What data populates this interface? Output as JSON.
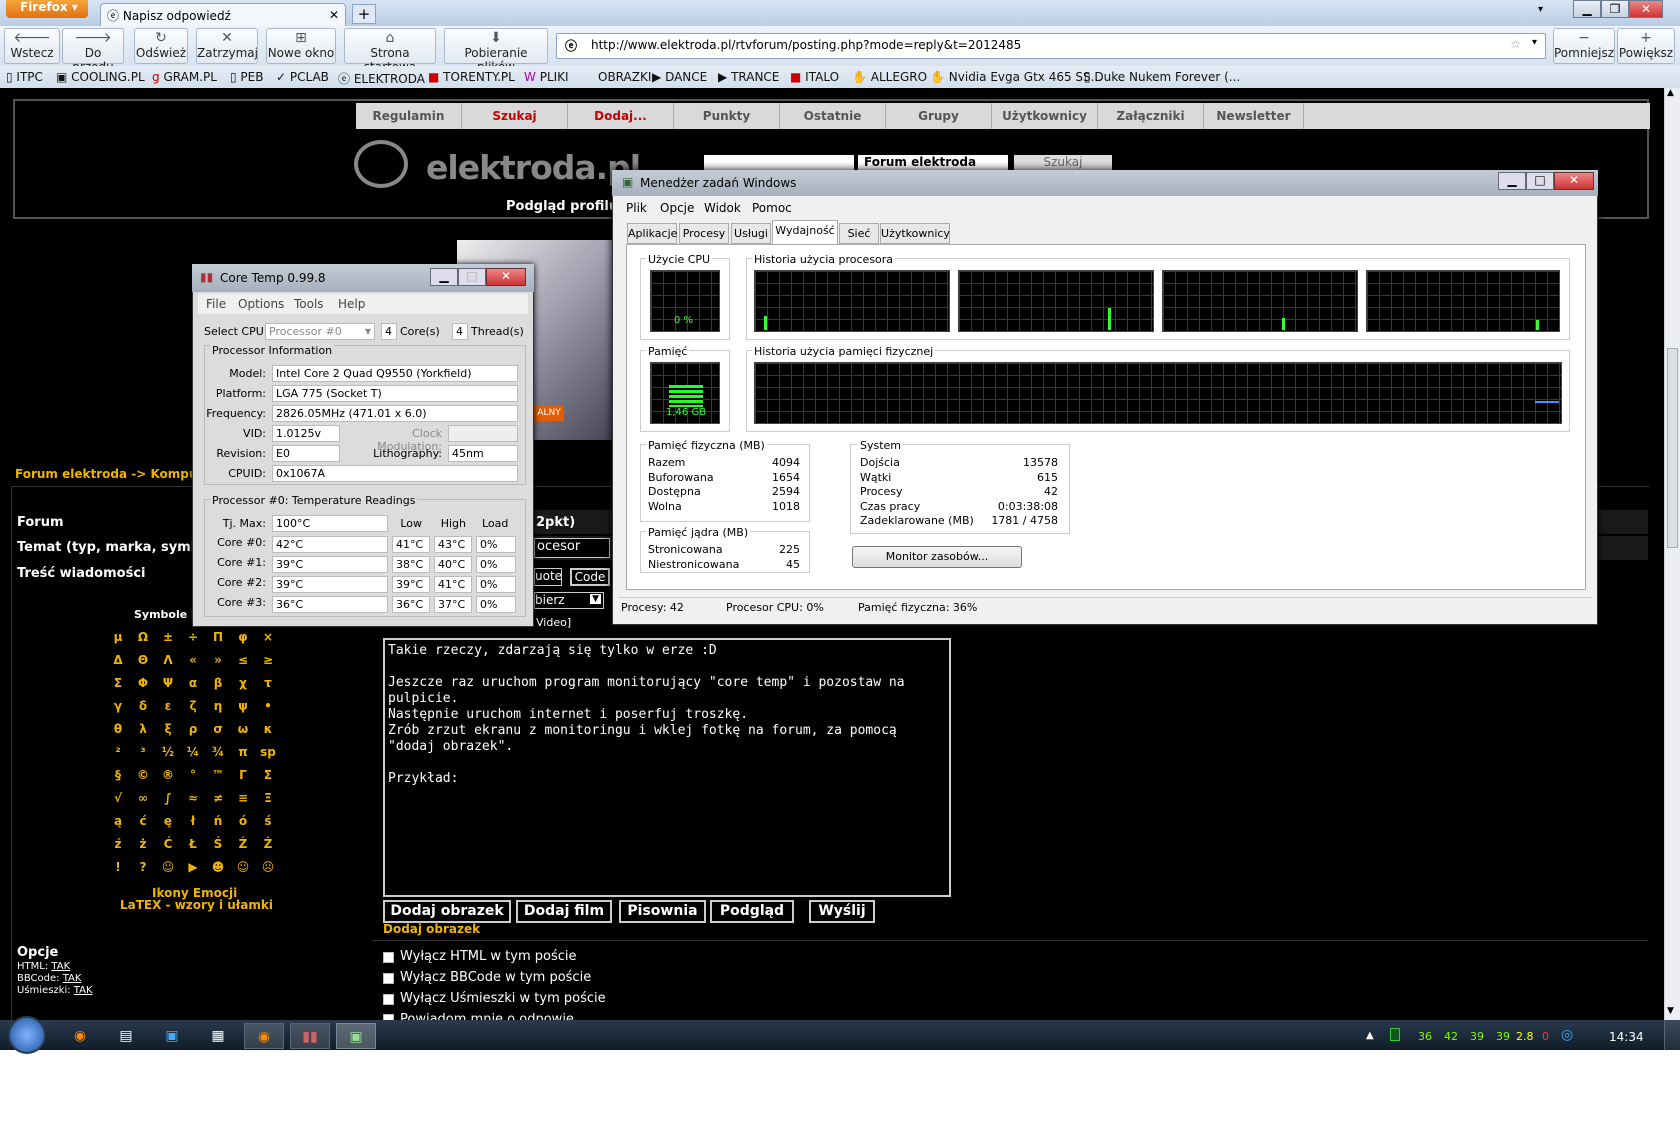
{
  "browser": {
    "menu_label": "Firefox",
    "tab_title": "Napisz odpowiedź",
    "url": "http://www.elektroda.pl/rtvforum/posting.php?mode=reply&t=2012485",
    "nav": {
      "back": "Wstecz",
      "forward": "Do przodu",
      "reload": "Odśwież",
      "stop": "Zatrzymaj",
      "new_window": "Nowe okno",
      "home": "Strona startowa",
      "downloads": "Pobieranie plików",
      "zoom_out": "Pomniejsz",
      "zoom_in": "Powiększ"
    },
    "bookmarks": [
      "ITPC",
      "COOLING.PL",
      "GRAM.PL",
      "PEB",
      "PCLAB",
      "ELEKTRODA",
      "TORENTY.PL",
      "PLIKI",
      "OBRAZKI",
      "DANCE",
      "TRANCE",
      "ITALO",
      "ALLEGRO",
      "Nvidia Evga Gtx 465 SS...",
      "Duke Nukem Forever (..."
    ]
  },
  "site": {
    "menu": [
      "Regulamin",
      "Szukaj",
      "Dodaj...",
      "Punkty",
      "Ostatnie",
      "Grupy",
      "Użytkownicy",
      "Załączniki",
      "Newsletter"
    ],
    "logo_text": "elektroda.pl",
    "search_select": "Forum elektroda",
    "search_btn": "Szukaj",
    "profile_preview": "Podgląd profilu",
    "breadcrumb": "Forum elektroda -> Kompu",
    "ad_badge": "ALNY",
    "labels": {
      "forum": "Forum",
      "topic": "Temat (typ, marka, symbo",
      "message": "Treść wiadomości",
      "symbols": "Symbole i",
      "pkt": "2pkt)",
      "topic_value": "ocesor",
      "quote": "uote",
      "code": "Code",
      "select": "bierz",
      "video": "Video]"
    },
    "symbols": [
      [
        "µ",
        "Ω",
        "±",
        "÷",
        "Π",
        "φ",
        "×"
      ],
      [
        "Δ",
        "Θ",
        "Λ",
        "«",
        "»",
        "≤",
        "≥"
      ],
      [
        "Σ",
        "Φ",
        "Ψ",
        "α",
        "β",
        "χ",
        "τ"
      ],
      [
        "γ",
        "δ",
        "ε",
        "ζ",
        "η",
        "ψ",
        "•"
      ],
      [
        "θ",
        "λ",
        "ξ",
        "ρ",
        "σ",
        "ω",
        "κ"
      ],
      [
        "²",
        "³",
        "½",
        "¼",
        "¾",
        "π",
        "sp"
      ],
      [
        "§",
        "©",
        "®",
        "°",
        "™",
        "Γ",
        "Σ"
      ],
      [
        "√",
        "∞",
        "∫",
        "≈",
        "≠",
        "≡",
        "Ξ"
      ],
      [
        "ą",
        "ć",
        "ę",
        "ł",
        "ń",
        "ó",
        "ś"
      ],
      [
        "ź",
        "ż",
        "Ć",
        "Ł",
        "Ś",
        "Ź",
        "Ż"
      ],
      [
        "!",
        "?",
        "☺",
        "▶",
        "☻",
        "☺",
        "☹"
      ]
    ],
    "emoticons": "Ikony Emocji",
    "latex": "LaTEX - wzory i ułamki",
    "message_text": "Takie rzeczy, zdarzają się tylko w erze :D\n\nJeszcze raz uruchom program monitorujący \"core temp\" i pozostaw na pulpicie.\nNastępnie uruchom internet i poserfuj troszkę.\nZrób zrzut ekranu z monitoringu i wklej fotkę na forum, za pomocą \"dodaj obrazek\".\n\nPrzykład:",
    "buttons": [
      "Dodaj obrazek",
      "Dodaj film",
      "Pisownia",
      "Podgląd",
      "Wyślij"
    ],
    "add_image_link": "Dodaj obrazek",
    "options": {
      "title": "Opcje",
      "html": "HTML:",
      "bbcode": "BBCode:",
      "smilies": "Uśmieszki:",
      "yes": "TAK"
    },
    "checkboxes": [
      "Wyłącz HTML w tym poście",
      "Wyłącz BBCode w tym poście",
      "Wyłącz Uśmieszki w tym poście",
      "Powiadom mnie o odpowie"
    ]
  },
  "coretemp": {
    "title": "Core Temp 0.99.8",
    "menu": [
      "File",
      "Options",
      "Tools",
      "Help"
    ],
    "select_cpu_label": "Select CPU:",
    "select_cpu": "Processor #0",
    "cores": "4",
    "cores_label": "Core(s)",
    "threads": "4",
    "threads_label": "Thread(s)",
    "info_header": "Processor Information",
    "model_label": "Model:",
    "model": "Intel Core 2 Quad Q9550 (Yorkfield)",
    "platform_label": "Platform:",
    "platform": "LGA 775 (Socket T)",
    "freq_label": "Frequency:",
    "freq": "2826.05MHz (471.01 x 6.0)",
    "vid_label": "VID:",
    "vid": "1.0125v",
    "clockmod_label": "Clock Modulation:",
    "revision_label": "Revision:",
    "revision": "E0",
    "litho_label": "Lithography:",
    "litho": "45nm",
    "cpuid_label": "CPUID:",
    "cpuid": "0x1067A",
    "temp_header": "Processor #0: Temperature Readings",
    "tjmax_label": "Tj. Max:",
    "tjmax": "100°C",
    "col_low": "Low",
    "col_high": "High",
    "col_load": "Load",
    "cores_data": [
      {
        "name": "Core #0:",
        "temp": "42°C",
        "low": "41°C",
        "high": "43°C",
        "load": "0%"
      },
      {
        "name": "Core #1:",
        "temp": "39°C",
        "low": "38°C",
        "high": "40°C",
        "load": "0%"
      },
      {
        "name": "Core #2:",
        "temp": "39°C",
        "low": "39°C",
        "high": "41°C",
        "load": "0%"
      },
      {
        "name": "Core #3:",
        "temp": "36°C",
        "low": "36°C",
        "high": "37°C",
        "load": "0%"
      }
    ]
  },
  "taskmgr": {
    "title": "Menedżer zadań Windows",
    "menu": [
      "Plik",
      "Opcje",
      "Widok",
      "Pomoc"
    ],
    "tabs": [
      "Aplikacje",
      "Procesy",
      "Usługi",
      "Wydajność",
      "Sieć",
      "Użytkownicy"
    ],
    "cpu_usage_label": "Użycie CPU",
    "cpu_usage": "0 %",
    "cpu_history_label": "Historia użycia procesora",
    "mem_label": "Pamięć",
    "mem_value": "1,46 GB",
    "mem_history_label": "Historia użycia pamięci fizycznej",
    "phys_header": "Pamięć fizyczna (MB)",
    "phys": [
      [
        "Razem",
        "4094"
      ],
      [
        "Buforowana",
        "1654"
      ],
      [
        "Dostępna",
        "2594"
      ],
      [
        "Wolna",
        "1018"
      ]
    ],
    "kernel_header": "Pamięć jądra (MB)",
    "kernel": [
      [
        "Stronicowana",
        "225"
      ],
      [
        "Niestronicowana",
        "45"
      ]
    ],
    "system_header": "System",
    "system": [
      [
        "Dojścia",
        "13578"
      ],
      [
        "Wątki",
        "615"
      ],
      [
        "Procesy",
        "42"
      ],
      [
        "Czas pracy",
        "0:03:38:08"
      ],
      [
        "Zadeklarowane (MB)",
        "1781 / 4758"
      ]
    ],
    "monitor_btn": "Monitor zasobów...",
    "status": [
      "Procesy: 42",
      "Procesor CPU: 0%",
      "Pamięć fizyczna: 36%"
    ]
  },
  "taskbar": {
    "clock": "14:34",
    "tray": [
      "36",
      "42",
      "39",
      "39",
      "2.8",
      "0"
    ]
  }
}
